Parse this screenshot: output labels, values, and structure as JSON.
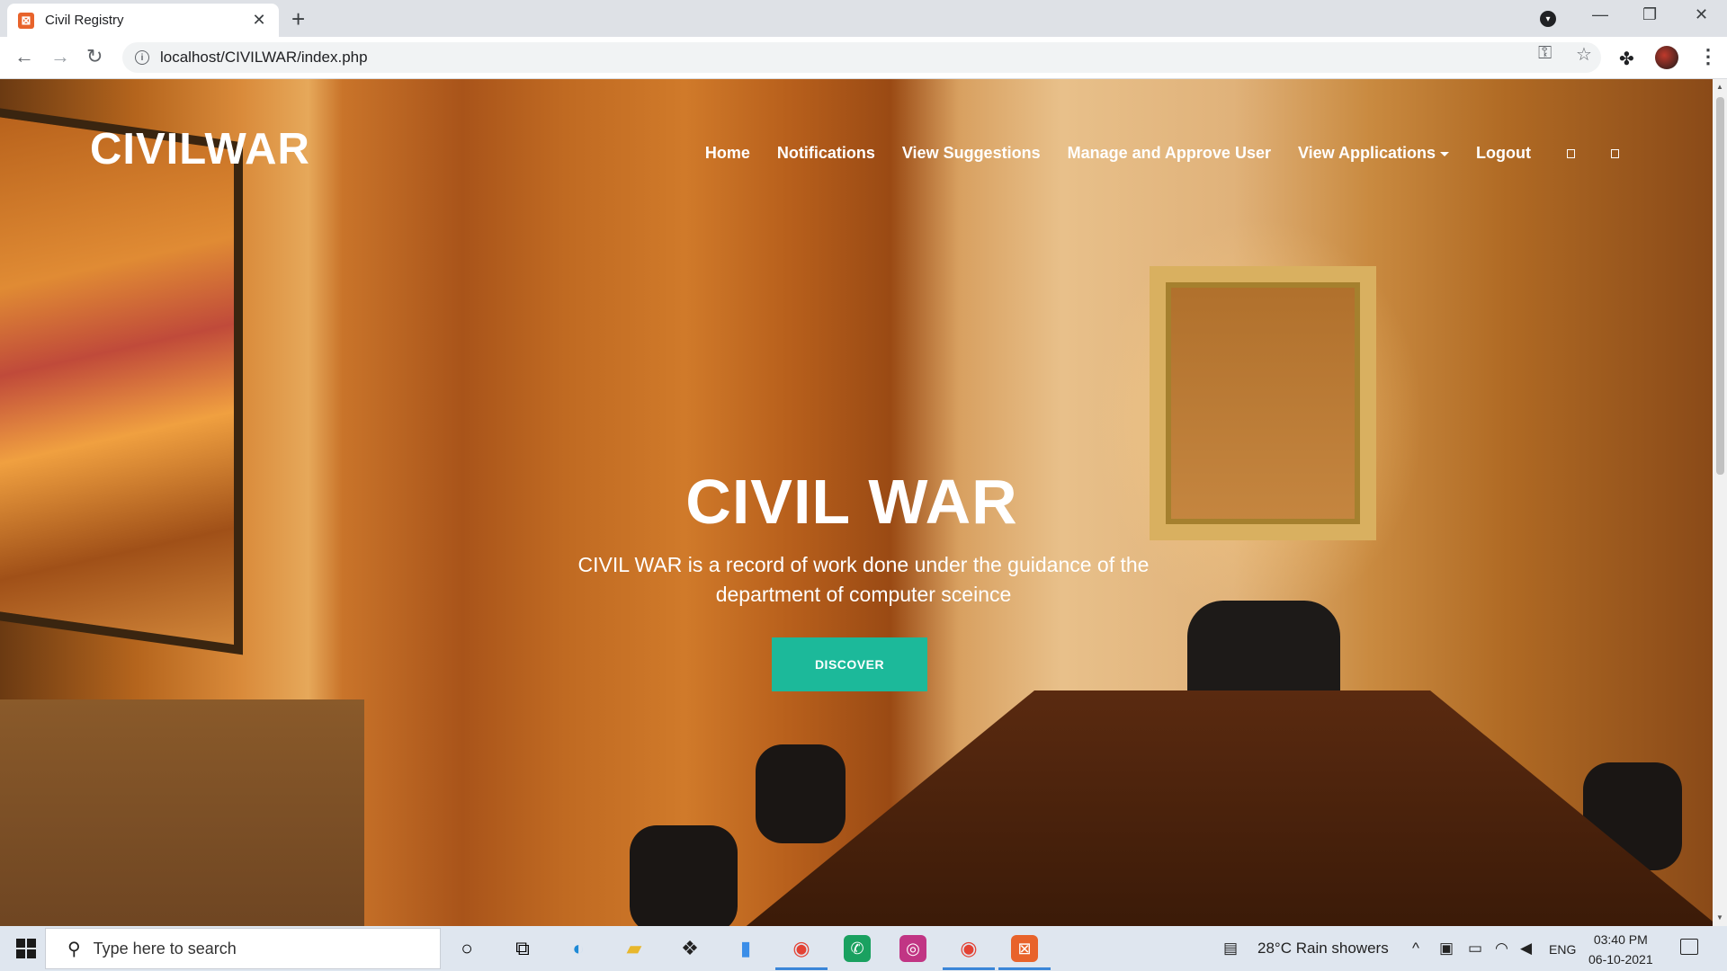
{
  "browser": {
    "tab_title": "Civil Registry",
    "tab_close": "✕",
    "new_tab": "+",
    "url": "localhost/CIVILWAR/index.php"
  },
  "site": {
    "brand": "CIVILWAR",
    "nav": {
      "home": "Home",
      "notifications": "Notifications",
      "suggestions": "View Suggestions",
      "manage_users": "Manage and Approve User",
      "applications": "View Applications",
      "logout": "Logout"
    },
    "hero": {
      "title": "CIVIL WAR",
      "subtitle": "CIVIL WAR is a record of work done under the guidance of the department of computer sceince",
      "cta": "DISCOVER"
    },
    "colors": {
      "cta": "#1cb99a"
    }
  },
  "taskbar": {
    "search_placeholder": "Type here to search",
    "weather": "28°C  Rain showers",
    "lang": "ENG",
    "time": "03:40 PM",
    "date": "06-10-2021",
    "icons": [
      "windows-start",
      "cortana",
      "task-view",
      "edge",
      "file-explorer",
      "dropbox",
      "phone",
      "chrome",
      "whatsapp",
      "instagram",
      "chrome-profile",
      "xampp"
    ]
  }
}
